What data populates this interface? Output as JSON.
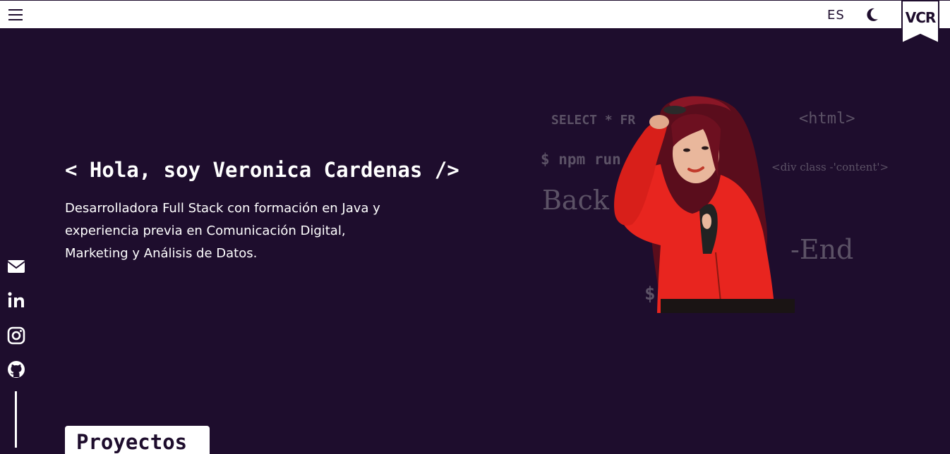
{
  "header": {
    "language_label": "ES",
    "logo_text": "VCR",
    "icons": {
      "menu": "hamburger-menu-icon",
      "theme": "moon-icon"
    }
  },
  "hero": {
    "title": "< Hola, soy Veronica Cardenas />",
    "description": "Desarrolladora Full Stack con formación en Java y experiencia previa en Comunicación Digital, Marketing y Análisis de Datos."
  },
  "background_code_words": {
    "select": "SELECT * FR",
    "html": "<html>",
    "npm": "$ npm run de",
    "div_class": "<div class -'content'>",
    "back": "Back",
    "end": "-End",
    "dollar": "$"
  },
  "social_links": [
    {
      "name": "email",
      "icon": "envelope-icon"
    },
    {
      "name": "linkedin",
      "icon": "linkedin-icon"
    },
    {
      "name": "instagram",
      "icon": "instagram-icon"
    },
    {
      "name": "github",
      "icon": "github-icon"
    }
  ],
  "sections": {
    "projects_label": "Proyectos"
  },
  "colors": {
    "background": "#1e0d2d",
    "header": "#ffffff",
    "accent_red": "#e8251f",
    "code_text": "#5c5266"
  }
}
